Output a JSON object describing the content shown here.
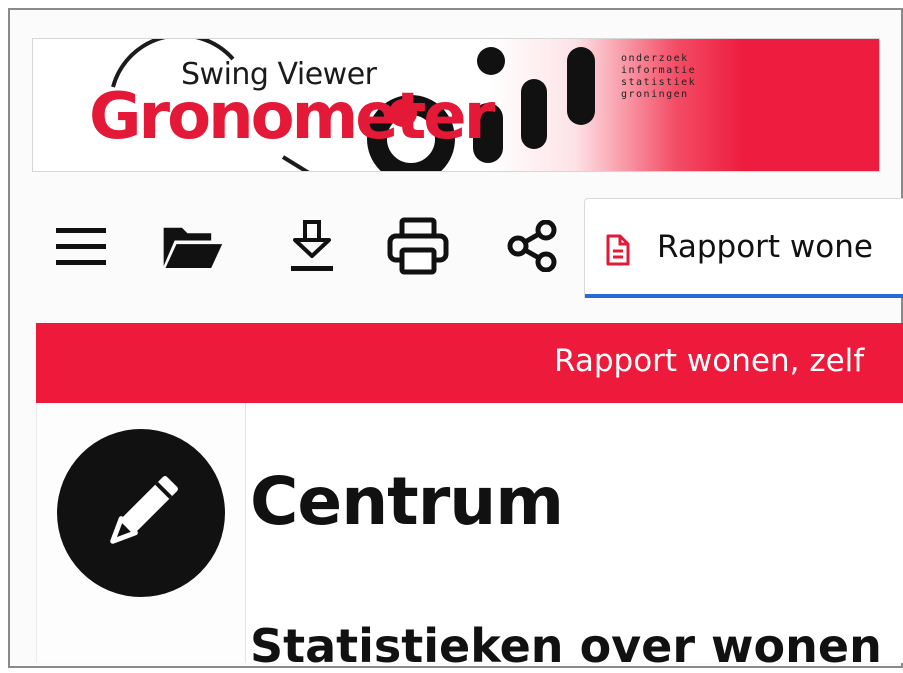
{
  "banner": {
    "app_name": "Swing Viewer",
    "logo_wordmark": "Gronometer",
    "org_lines": [
      "onderzoek",
      "informatie",
      "statistiek",
      "groningen"
    ],
    "accent_color": "#ee1a3b"
  },
  "toolbar": {
    "buttons": [
      {
        "name": "menu",
        "icon": "hamburger-icon"
      },
      {
        "name": "open",
        "icon": "folder-open-icon"
      },
      {
        "name": "download",
        "icon": "download-icon"
      },
      {
        "name": "print",
        "icon": "print-icon"
      },
      {
        "name": "share",
        "icon": "share-icon"
      }
    ],
    "active_tab": {
      "label": "Rapport wone",
      "icon": "document-icon"
    }
  },
  "report_bar": {
    "title": "Rapport wonen, zelf"
  },
  "content": {
    "edit_icon": "pencil-icon",
    "title": "Centrum",
    "subtitle": "Statistieken over wonen"
  }
}
